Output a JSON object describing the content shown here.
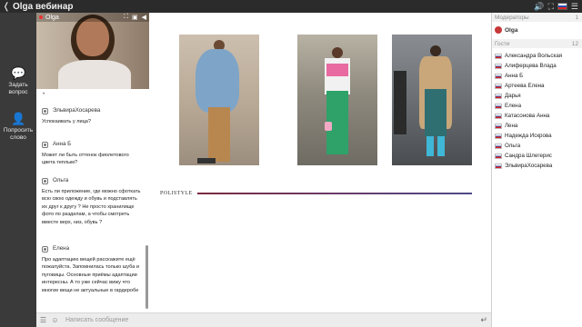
{
  "topbar": {
    "title": "Olga вебинар"
  },
  "rail": {
    "ask_question": "Задать вопрос",
    "ask_to_speak": "Попросить слово"
  },
  "video": {
    "speaker": "Olga"
  },
  "chat": {
    "messages": [
      {
        "author": "ЭльвираХосарева",
        "text": "Успокаивать у лица?"
      },
      {
        "author": "Анна Б",
        "text": "Может ли быть оттенок фиолетового цвета теплым?"
      },
      {
        "author": "Ольга",
        "text": "Есть ли приложение, где можно сфоткать всю свою одежду и обувь и подставлять их друг к другу ? Не просто хранилище фото по разделам, а чтобы смотреть вместе верх, низ, обувь ?"
      },
      {
        "author": "Елена",
        "text": "Про адаптацию вещей расскажите ещё пожалуйста. Запомнилась только шуба и пуговицы. Основные приёмы адаптации интересны. А то уже сейчас вижу что многие вещи не актуальные в гардеробе"
      }
    ],
    "input_placeholder": "Написать сообщение"
  },
  "slide": {
    "brand": "POLISTYLE"
  },
  "panel": {
    "moderators_label": "Модераторы",
    "moderators_count": "1",
    "moderator_name": "Olga",
    "guests_label": "Гости",
    "guests_count": "12",
    "guests": [
      "Александра Вольская",
      "Алиферцева Влада",
      "Анна Б",
      "Артеева Елена",
      "Дарья",
      "Елена",
      "Катасонова Анна",
      "Лена",
      "Надежда Искрова",
      "Ольга",
      "Сандра Шлегерис",
      "ЭльвираХосарева"
    ]
  }
}
